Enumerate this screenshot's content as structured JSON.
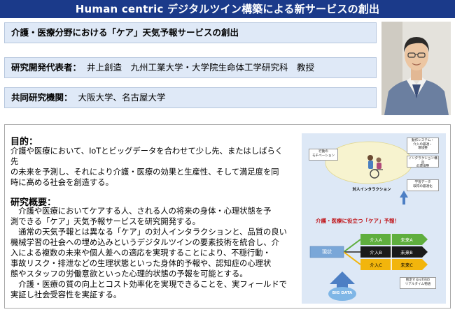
{
  "header": {
    "title": "Human centric デジタルツイン構築による新サービスの創出"
  },
  "info": {
    "project_title": "介護・医療分野における「ケア」天気予報サービスの創出",
    "rep_label": "研究開発代表者：",
    "rep_value": "井上創造　九州工業大学・大学院生命体工学研究科　教授",
    "joint_label": "共同研究機関：",
    "joint_value": "大阪大学、名古屋大学"
  },
  "purpose": {
    "heading": "目的：",
    "lines": [
      "介護や医療において、IoTとビッグデータを合わせて少し先、またはしばらく先",
      "の未来を予測し、それにより介護・医療の効果と生産性、そして満足度を同",
      "時に高める社会を創造する。"
    ]
  },
  "overview": {
    "heading": "研究概要：",
    "lines": [
      "　介護や医療においてケアする人、される人の将来の身体・心理状態を予",
      "測できる「ケア」天気予報サービスを研究開発する。",
      "　通常の天気予報とは異なる「ケア」の対人インタラクションと、品質の良い",
      "機械学習の社会への埋め込みというデジタルツインの要素技術を統合し、介",
      "入による複数の未来や個人差への適応を実現することにより、不穏行動・",
      "事故リスク・排泄などの生理状態といった身体的予報や、認知症の心理状",
      "態やスタッフの労働意欲といった心理的状態の予報を可能とする。",
      "　介護・医療の質の向上とコスト効率化を実現できることを、実フィールドで",
      "実証し社会受容性を実証する。"
    ]
  },
  "diagram": {
    "bubble_left": [
      "行動の",
      "モチベーション"
    ],
    "bubble_right_top": [
      "動作システム・",
      "介入の最適・",
      "環境整"
    ],
    "bubble_right_mid": [
      "インタラクション構造",
      "の環境整"
    ],
    "caption_person": "対人インタラクション",
    "bubble_data": [
      "学習データ",
      "取得の最適化"
    ],
    "forecast_title": "介護・医療に役立つ「ケア」予報！",
    "current_label": "現状",
    "rows": [
      {
        "intervention": "介入A",
        "future": "未来A"
      },
      {
        "intervention": "介入B",
        "future": "未来B"
      },
      {
        "intervention": "介入C",
        "future": "未来C"
      }
    ],
    "bigdata_label": "BIG DATA",
    "bubble_bottom": [
      "暫定するIoT向の",
      "リアルタイム物語"
    ]
  },
  "colors": {
    "title_bar": "#1b3a8a",
    "info_bg": "#dfe9f7",
    "panel_bg": "#dde8f6",
    "row_a": "#5fae3e",
    "row_b": "#1a1a1a",
    "row_c": "#f2b50c",
    "forecast_title": "#c0161b"
  }
}
